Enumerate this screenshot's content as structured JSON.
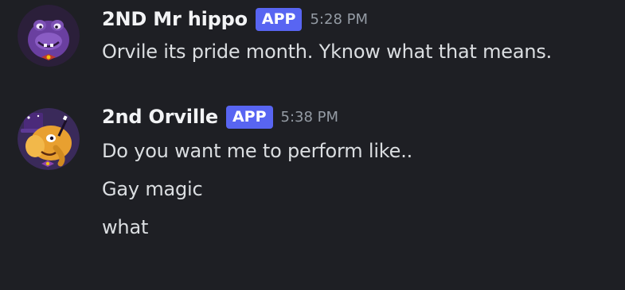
{
  "messages": [
    {
      "username": "2ND Mr hippo",
      "badge": "APP",
      "timestamp": "5:28 PM",
      "avatar": "purple-hippo-avatar",
      "lines": [
        "Orvile its pride month. Yknow what that means."
      ]
    },
    {
      "username": "2nd Orville",
      "badge": "APP",
      "timestamp": "5:38 PM",
      "avatar": "orange-elephant-magician-avatar",
      "lines": [
        "Do you want me to perform like..",
        "Gay magic",
        "what"
      ]
    }
  ],
  "colors": {
    "background": "#1e1f24",
    "username": "#f2f3f5",
    "badge": "#5865f2",
    "timestamp": "#949ba4",
    "message_text": "#dbdee1"
  }
}
